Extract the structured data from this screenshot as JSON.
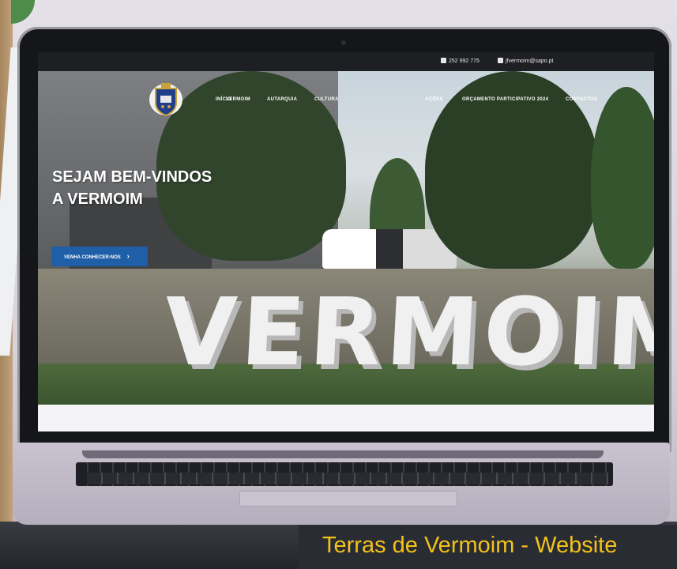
{
  "topbar": {
    "phone": "252 992 775",
    "email": "jfvermoim@sapo.pt"
  },
  "nav": {
    "items": [
      "INÍCIO",
      "VERMOIM",
      "AUTARQUIA",
      "CULTURA",
      "AÇÕES",
      "ORÇAMENTO PARTICIPATIVO 2024",
      "CONTACTOS"
    ]
  },
  "hero": {
    "line1": "SEJAM BEM-VINDOS",
    "line2": "A VERMOIM",
    "cta_label": "VENHA CONHECER-NOS",
    "sign_text": "VERMOIM"
  },
  "caption": "Terras de Vermoim - Website",
  "colors": {
    "accent": "#1f5fa8",
    "caption_text": "#f2c21b",
    "topbar": "#1e1f22"
  },
  "icons": [
    "phone-icon",
    "email-icon",
    "chevron-right-icon"
  ]
}
